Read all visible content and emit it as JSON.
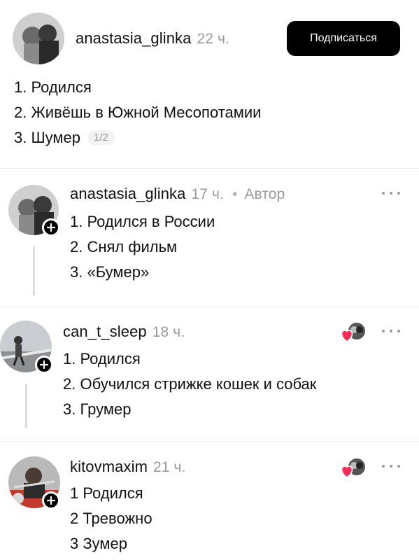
{
  "post": {
    "username": "anastasia_glinka",
    "time": "22 ч.",
    "follow_label": "Подписаться",
    "lines": [
      "1. Родился",
      "2. Живёшь в Южной Месопотамии",
      "3. Шумер"
    ],
    "translate_counter": "1/2"
  },
  "replies": [
    {
      "username": "anastasia_glinka",
      "time": "17 ч.",
      "dot": "•",
      "author_label": "Автор",
      "lines": [
        "1. Родился в России",
        "2. Снял фильм",
        "3. «Бумер»"
      ]
    },
    {
      "username": "can_t_sleep",
      "time": "18 ч.",
      "lines": [
        "1. Родился",
        "2. Обучился стрижке кошек и собак",
        "3. Грумер"
      ]
    },
    {
      "username": "kitovmaxim",
      "time": "21 ч.",
      "lines": [
        "1 Родился",
        "2 Тревожно",
        "3 Зумер"
      ]
    }
  ],
  "icons": {
    "plus": "plus-icon",
    "more": "more-icon",
    "heart": "heart-icon"
  },
  "colors": {
    "accent": "#000000",
    "heart": "#ff2d55",
    "muted": "#9a9a9a"
  }
}
